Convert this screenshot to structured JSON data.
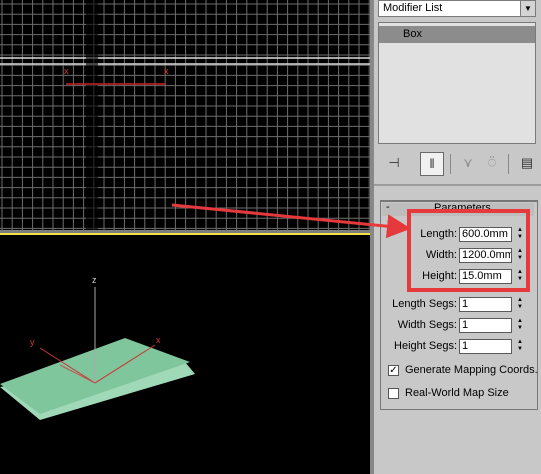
{
  "app": {
    "accent_highlight": "#e5393c",
    "active_viewport_border": "#f5e04a",
    "box_color": "#7fc69c"
  },
  "viewport_top": {
    "axis_labels": [
      "x",
      "x"
    ]
  },
  "viewport_perspective": {
    "axis_labels": {
      "z": "z",
      "y": "y",
      "x": "x"
    }
  },
  "command_panel": {
    "modifier_list": {
      "label": "Modifier List",
      "arrow": "▼"
    },
    "stack": {
      "items": [
        {
          "label": "Box"
        }
      ]
    },
    "toolbar": [
      {
        "name": "pin-stack-icon",
        "glyph": "⊣"
      },
      {
        "name": "show-end-result-icon",
        "glyph": "‖"
      },
      {
        "name": "make-unique-icon",
        "glyph": "⋎"
      },
      {
        "name": "remove-modifier-icon",
        "glyph": "⍥"
      },
      {
        "name": "configure-modifier-sets-icon",
        "glyph": "▤"
      }
    ],
    "rollout": {
      "minus": "-",
      "title": "Parameters"
    },
    "params": [
      {
        "label": "Length:",
        "value": "600.0mm"
      },
      {
        "label": "Width:",
        "value": "1200.0mm"
      },
      {
        "label": "Height:",
        "value": "15.0mm"
      },
      {
        "label": "Length Segs:",
        "value": "1"
      },
      {
        "label": "Width Segs:",
        "value": "1"
      },
      {
        "label": "Height Segs:",
        "value": "1"
      }
    ],
    "spinner": {
      "up": "▲",
      "down": "▼"
    },
    "checkboxes": [
      {
        "label": "Generate Mapping Coords.",
        "mark": "✓",
        "checked": true
      },
      {
        "label": "Real-World Map Size",
        "mark": "",
        "checked": false
      }
    ]
  }
}
